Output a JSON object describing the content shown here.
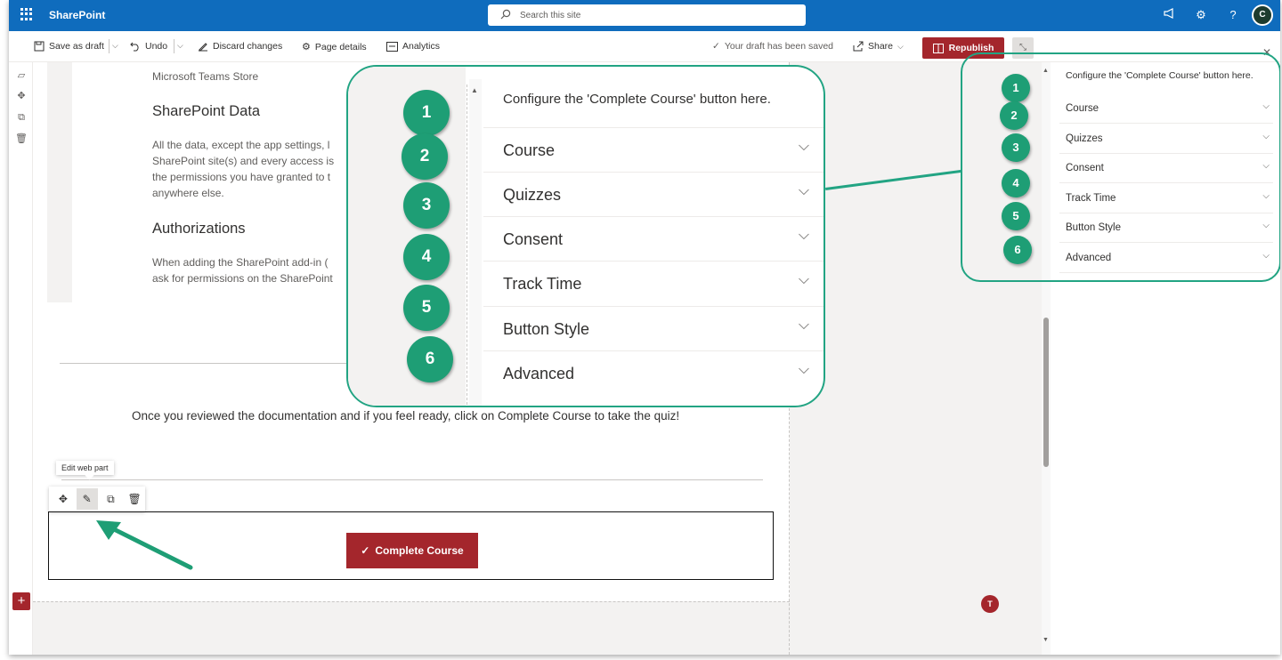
{
  "suite": {
    "app_name": "SharePoint",
    "search_placeholder": "Search this site"
  },
  "commands": {
    "save_as_draft": "Save as draft",
    "undo": "Undo",
    "discard_changes": "Discard changes",
    "page_details": "Page details",
    "analytics": "Analytics",
    "draft_status": "Your draft has been saved",
    "share": "Share",
    "republish": "Republish"
  },
  "document": {
    "line0": "Microsoft Teams Store",
    "heading1": "SharePoint Data",
    "para1": [
      "All the data, except the app settings, l",
      "SharePoint site(s) and every access is",
      "the permissions you have granted to t",
      "anywhere else."
    ],
    "heading2": "Authorizations",
    "para2": [
      "When adding the SharePoint add-in (",
      "ask for permissions on the SharePoint"
    ],
    "note": "Once you reviewed the documentation and if you feel ready, click on Complete Course to take the quiz!"
  },
  "webpart": {
    "tooltip": "Edit web part",
    "button_label": "Complete Course"
  },
  "property_pane": {
    "title": "Configure the 'Complete Course' button here.",
    "sections": [
      "Course",
      "Quizzes",
      "Consent",
      "Track Time",
      "Button Style",
      "Advanced"
    ]
  },
  "badges": [
    "1",
    "2",
    "3",
    "4",
    "5",
    "6"
  ],
  "colors": {
    "suite_blue": "#0f6cbd",
    "brand_red": "#a4262c",
    "callout_green": "#22a483"
  }
}
